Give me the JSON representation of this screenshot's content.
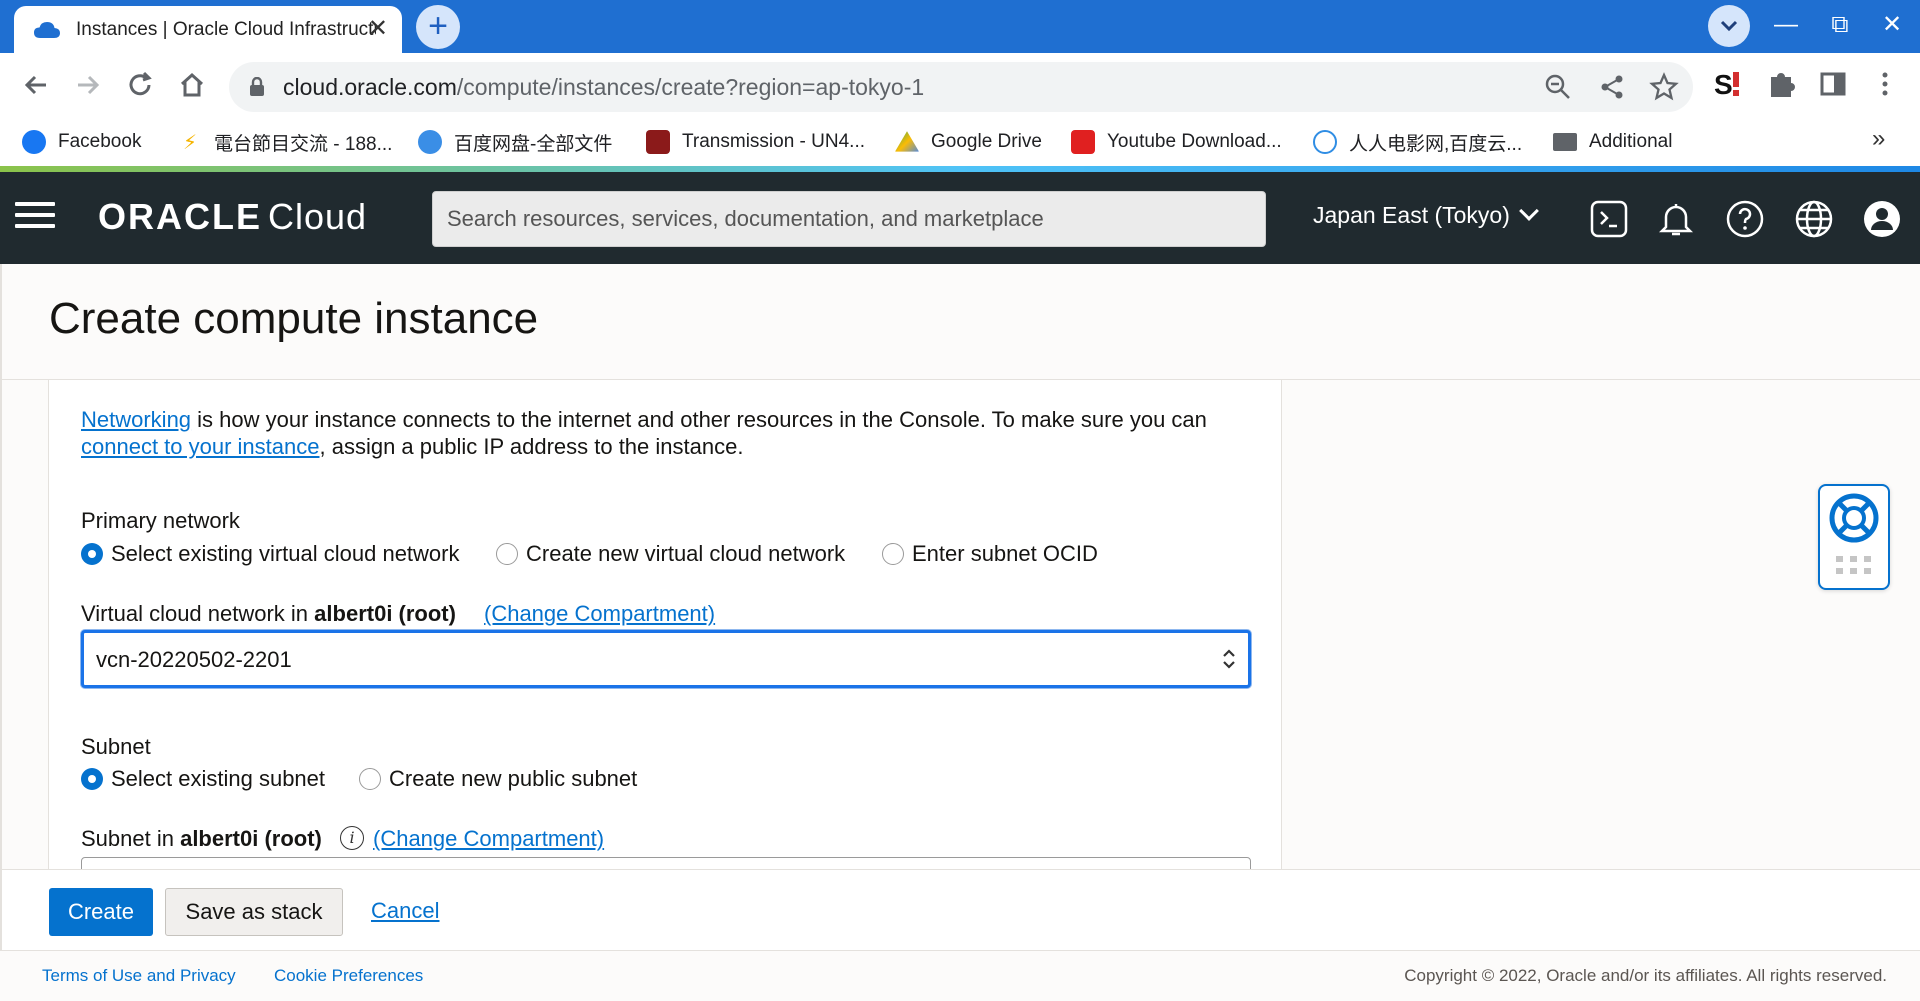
{
  "browser": {
    "tab_title": "Instances | Oracle Cloud Infrastructure",
    "tab_close": "✕",
    "new_tab": "+",
    "window_controls": {
      "minimize": "—",
      "restore": "⧉",
      "close": "✕"
    },
    "url_host": "cloud.oracle.com",
    "url_path": "/compute/instances/create?region=ap-tokyo-1",
    "bookmarks": [
      {
        "label": "Facebook",
        "icon": "facebook-icon",
        "color": "#1877f2"
      },
      {
        "label": "電台節目交流 - 188...",
        "icon": "lightning-icon",
        "color": "#f5b400"
      },
      {
        "label": "百度网盘-全部文件",
        "icon": "baidu-cloud-icon",
        "color": "#3a8ee6"
      },
      {
        "label": "Transmission - UN4...",
        "icon": "transmission-icon",
        "color": "#8b1a1a"
      },
      {
        "label": "Google Drive",
        "icon": "google-drive-icon",
        "color": "#34a853"
      },
      {
        "label": "Youtube Download...",
        "icon": "download-icon",
        "color": "#e02020"
      },
      {
        "label": "人人电影网,百度云...",
        "icon": "rr-icon",
        "color": "#2f8de4"
      },
      {
        "label": "Additional",
        "icon": "folder-icon",
        "color": "#5f6368"
      }
    ],
    "bookmarks_more": "»"
  },
  "oci": {
    "logo_brand": "ORACLE",
    "logo_product": "Cloud",
    "search_placeholder": "Search resources, services, documentation, and marketplace",
    "region": "Japan East (Tokyo)"
  },
  "page": {
    "title": "Create compute instance"
  },
  "networking": {
    "intro_link1": "Networking",
    "intro_text1": " is how your instance connects to the internet and other resources in the Console. To make sure you can ",
    "intro_link2": "connect to your instance",
    "intro_text2": ", assign a public IP address to the instance.",
    "primary_network_label": "Primary network",
    "primary_network_options": [
      {
        "label": "Select existing virtual cloud network",
        "checked": true
      },
      {
        "label": "Create new virtual cloud network",
        "checked": false
      },
      {
        "label": "Enter subnet OCID",
        "checked": false
      }
    ],
    "vcn_label_prefix": "Virtual cloud network in ",
    "vcn_compartment": "albert0i (root)",
    "change_compartment": "(Change Compartment)",
    "vcn_value": "vcn-20220502-2201",
    "subnet_label": "Subnet",
    "subnet_options": [
      {
        "label": "Select existing subnet",
        "checked": true
      },
      {
        "label": "Create new public subnet",
        "checked": false
      }
    ],
    "subnet_in_prefix": "Subnet in ",
    "subnet_compartment": "albert0i (root)",
    "info_glyph": "i"
  },
  "actions": {
    "create": "Create",
    "save_as_stack": "Save as stack",
    "cancel": "Cancel"
  },
  "footer": {
    "terms": "Terms of Use and Privacy",
    "cookies": "Cookie Preferences",
    "copyright": "Copyright © 2022, Oracle and/or its affiliates. All rights reserved."
  },
  "colors": {
    "oracle_header": "#202a2f",
    "primary_blue": "#0572ce",
    "chrome_tabbar": "#1f6fd1"
  }
}
